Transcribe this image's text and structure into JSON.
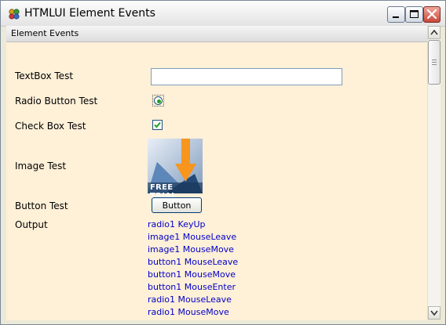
{
  "window": {
    "title": "HTMLUI Element Events",
    "app_icon": "htmlui-app-icon",
    "controls": {
      "minimize": "minimize-icon",
      "maximize": "maximize-icon",
      "close": "close-icon"
    }
  },
  "header": {
    "label": "Element Events"
  },
  "form": {
    "textbox": {
      "label": "TextBox Test",
      "value": "",
      "placeholder": ""
    },
    "radio": {
      "label": "Radio Button Test",
      "selected": true
    },
    "checkbox": {
      "label": "Check Box Test",
      "checked": true
    },
    "image": {
      "label": "Image Test",
      "caption": "FREE TRIAL",
      "icon": "download-arrow-icon"
    },
    "button": {
      "label": "Button Test",
      "text": "Button"
    }
  },
  "output": {
    "label": "Output",
    "events": [
      "radio1 KeyUp",
      "image1 MouseLeave",
      "image1 MouseMove",
      "button1 MouseLeave",
      "button1 MouseMove",
      "button1 MouseEnter",
      "radio1 MouseLeave",
      "radio1 MouseMove"
    ],
    "color": "#0000c8"
  },
  "colors": {
    "content_background": "#fff0d8",
    "text": "#000000",
    "close_button": "#c9483a"
  }
}
